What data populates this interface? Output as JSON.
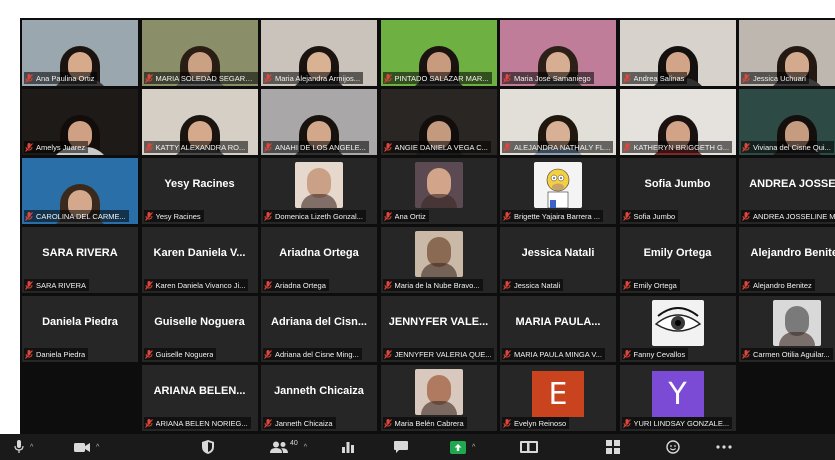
{
  "meeting": {
    "participants_count": "40",
    "participants": [
      {
        "name": "Ana Paulina Ortiz",
        "type": "video",
        "bg": "#9aa7ae",
        "hair": "#1a1310",
        "skin": "#d8aa8c",
        "shirt": "#3a3a3a"
      },
      {
        "name": "MARIA SOLEDAD SEGARRA...",
        "type": "video",
        "bg": "#8a8f6a",
        "hair": "#2a1e14",
        "skin": "#caa183",
        "shirt": "#5a5a5a",
        "active": true
      },
      {
        "name": "Maria Alejandra Armijos...",
        "type": "video",
        "bg": "#c9c3bb",
        "hair": "#1a1310",
        "skin": "#d9b193",
        "shirt": "#2c2c2c"
      },
      {
        "name": "PINTADO SALAZAR MAR...",
        "type": "video",
        "bg": "#6fb043",
        "hair": "#1a1310",
        "skin": "#c99b7e",
        "shirt": "#2a2a2a"
      },
      {
        "name": "Maria José Samaniego",
        "type": "video",
        "bg": "#c07d9a",
        "hair": "#2d2018",
        "skin": "#d7ae92",
        "shirt": "#444444"
      },
      {
        "name": "Andrea Salinas",
        "type": "video",
        "bg": "#d8d2cc",
        "hair": "#151010",
        "skin": "#d2a589",
        "shirt": "#303030"
      },
      {
        "name": "Jessica Uchuari",
        "type": "video",
        "bg": "#bdb7b0",
        "hair": "#231912",
        "skin": "#d3aa8d",
        "shirt": "#3c3c3c"
      },
      {
        "name": "Amelys Juarez",
        "type": "video",
        "bg": "#1e1a17",
        "hair": "#120d0a",
        "skin": "#cfa084",
        "shirt": "#c9c9c9"
      },
      {
        "name": "KATTY ALEXANDRA RO...",
        "type": "video",
        "bg": "#d6cfc6",
        "hair": "#1b140f",
        "skin": "#d5a98b",
        "shirt": "#4a4a4a"
      },
      {
        "name": "ANAHI DE LOS ANGELE...",
        "type": "video",
        "bg": "#a9a7a8",
        "hair": "#18120e",
        "skin": "#d3a789",
        "shirt": "#2e2e2e"
      },
      {
        "name": "ANGIE DANIELA VEGA C...",
        "type": "video",
        "bg": "#2a2624",
        "hair": "#120e0c",
        "skin": "#c49a7f",
        "shirt": "#1c1c1c"
      },
      {
        "name": "ALEJANDRA NATHALY FL...",
        "type": "video",
        "bg": "#e2ded8",
        "hair": "#20170f",
        "skin": "#d8b095",
        "shirt": "#8aa0b8"
      },
      {
        "name": "KATHERYN BRIGGETH G...",
        "type": "video",
        "bg": "#e5e1dc",
        "hair": "#1a1210",
        "skin": "#d2a387",
        "shirt": "#7a2a2a"
      },
      {
        "name": "Viviana del Cisne Qui...",
        "type": "video",
        "bg": "#2e4a44",
        "hair": "#140f0c",
        "skin": "#c69c80",
        "shirt": "#1e1e1e"
      },
      {
        "name": "CAROLINA DEL CARME...",
        "type": "video",
        "bg": "#2a6fa8",
        "hair": "#3a2a1e",
        "skin": "#d4a88c",
        "shirt": "#3a3a3a"
      },
      {
        "name": "Yesy Racines",
        "type": "name",
        "display": "Yesy Racines"
      },
      {
        "name": "Domenica Lizeth Gonzal...",
        "type": "photo",
        "photo_bg": "#e6d8cc",
        "photo_fg": "#caa087"
      },
      {
        "name": "Ana Ortiz",
        "type": "photo",
        "photo_bg": "#5b4a52",
        "photo_fg": "#d2a58a"
      },
      {
        "name": "Brigette Yajaira Barrera ...",
        "type": "homer"
      },
      {
        "name": "Sofia Jumbo",
        "type": "name",
        "display": "Sofia Jumbo"
      },
      {
        "name": "ANDREA JOSSELINE M...",
        "type": "name",
        "display": "ANDREA JOSSE..."
      },
      {
        "name": "SARA RIVERA",
        "type": "name",
        "display": "SARA RIVERA"
      },
      {
        "name": "Karen Daniela Vivanco Ji...",
        "type": "name",
        "display": "Karen Daniela V..."
      },
      {
        "name": "Ariadna Ortega",
        "type": "name",
        "display": "Ariadna Ortega"
      },
      {
        "name": "Maria de la Nube Bravo...",
        "type": "photo",
        "photo_bg": "#c9b9a6",
        "photo_fg": "#8a6a52"
      },
      {
        "name": "Jessica Natali",
        "type": "name",
        "display": "Jessica Natali"
      },
      {
        "name": "Emily Ortega",
        "type": "name",
        "display": "Emily Ortega"
      },
      {
        "name": "Alejandro Benitez",
        "type": "name",
        "display": "Alejandro Benitez"
      },
      {
        "name": "Daniela Piedra",
        "type": "name",
        "display": "Daniela Piedra"
      },
      {
        "name": "Guiselle Noguera",
        "type": "name",
        "display": "Guiselle Noguera"
      },
      {
        "name": "Adriana del Cisne Ming...",
        "type": "name",
        "display": "Adriana del Cisn..."
      },
      {
        "name": "JENNYFER VALERIA QUE...",
        "type": "name",
        "display": "JENNYFER VALE..."
      },
      {
        "name": "MARIA PAULA MINGA V...",
        "type": "name",
        "display": "MARIA PAULA..."
      },
      {
        "name": "Fanny Cevallos",
        "type": "eye"
      },
      {
        "name": "Carmen Otilia Aguilar...",
        "type": "photo",
        "photo_bg": "#d9d9d9",
        "photo_fg": "#7a7a7a"
      },
      {
        "name": "",
        "type": "empty"
      },
      {
        "name": "ARIANA BELEN NORIEG...",
        "type": "name",
        "display": "ARIANA BELEN..."
      },
      {
        "name": "Janneth Chicaiza",
        "type": "name",
        "display": "Janneth Chicaiza"
      },
      {
        "name": "Maria Belén Cabrera",
        "type": "photo",
        "photo_bg": "#d8c8bd",
        "photo_fg": "#b07a60"
      },
      {
        "name": "Evelyn Reinoso",
        "type": "letter",
        "letter": "E",
        "color": "#c9441e"
      },
      {
        "name": "YURI LINDSAY GONZALE...",
        "type": "letter",
        "letter": "Y",
        "color": "#7b4bd6"
      },
      {
        "name": "",
        "type": "empty"
      }
    ]
  },
  "toolbar": {
    "accent_green": "#1fa84f",
    "icons": [
      "microphone-icon",
      "video-camera-icon",
      "security-shield-icon",
      "participants-icon",
      "polls-icon",
      "chat-icon",
      "share-screen-icon",
      "record-icon",
      "breakout-rooms-icon",
      "reactions-icon",
      "more-icon"
    ]
  }
}
